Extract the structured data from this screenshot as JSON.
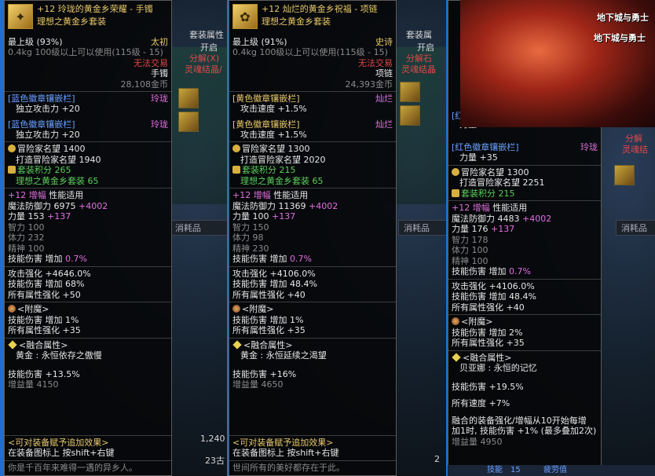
{
  "panels": [
    {
      "item_name": "+12 玲珑的黄金乡荣耀 - 手镯",
      "set_name": "理想之黄金乡套装",
      "grade": "最上级",
      "grade_pct": "(93%)",
      "rarity": "太初",
      "weight_req": "0.4kg  100级以上可以使用(115级 - 15)",
      "trade": "无法交易",
      "type": "手镯",
      "price": "28,108金币",
      "emblems": [
        {
          "slot": "[蓝色徽章镶嵌栏]",
          "gem": "玲珑",
          "stat": "独立攻击力 +20"
        },
        {
          "slot": "[蓝色徽章镶嵌栏]",
          "gem": "玲珑",
          "stat": "独立攻击力 +20"
        }
      ],
      "fame_label": "冒险家名望",
      "fame": "1400",
      "craft_fame_label": "打造冒险家名望",
      "craft_fame": "1940",
      "set_points_label": "套装积分",
      "set_points": "265",
      "set_line": "理想之黄金乡套装 65",
      "amp": "+12 增幅",
      "amp_note": "性能适用",
      "defense_label": "魔法防御力",
      "defense": "6975",
      "defense_bonus": "+4002",
      "stats": [
        {
          "label": "力量",
          "value": "153",
          "bonus": "+137"
        },
        {
          "label": "智力",
          "value": "100",
          "bonus": ""
        },
        {
          "label": "体力",
          "value": "232",
          "bonus": ""
        },
        {
          "label": "精神",
          "value": "100",
          "bonus": ""
        }
      ],
      "skill_line": "技能伤害 增加",
      "skill_val": "0.7%",
      "strong": [
        "攻击强化 +4646.0%",
        "技能伤害 增加 68%",
        "所有属性强化 +50"
      ],
      "enchant_label": "<附魔>",
      "enchant": [
        "技能伤害 增加 1%",
        "所有属性强化 +35"
      ],
      "fusion_label": "融合属性>",
      "fusion_name": "黄金 : 永恒依存之傲慢",
      "fusion_stats": [
        "技能伤害 +13.5%",
        "增益量 4150"
      ],
      "footer": [
        "<可对装备赋予追加效果>",
        "在装备图标上 按shift+右键",
        "你是千百年来难得一遇的异乡人。"
      ]
    },
    {
      "item_name": "+12 灿烂的黄金乡祝福 - 项链",
      "set_name": "理想之黄金乡套装",
      "grade": "最上级",
      "grade_pct": "(91%)",
      "rarity": "史诗",
      "weight_req": "0.4kg  100级以上可以使用(115级 - 15)",
      "trade": "无法交易",
      "type": "项链",
      "price": "24,393金币",
      "emblems": [
        {
          "slot": "[黄色徽章镶嵌栏]",
          "gem": "灿烂",
          "stat": "攻击速度 +1.5%"
        },
        {
          "slot": "[黄色徽章镶嵌栏]",
          "gem": "灿烂",
          "stat": "攻击速度 +1.5%"
        }
      ],
      "fame_label": "冒险家名望",
      "fame": "1300",
      "craft_fame_label": "打造冒险家名望",
      "craft_fame": "2020",
      "set_points_label": "套装积分",
      "set_points": "215",
      "set_line": "理想之黄金乡套装 65",
      "amp": "+12 增幅",
      "amp_note": "性能适用",
      "defense_label": "魔法防御力",
      "defense": "11369",
      "defense_bonus": "+4002",
      "stats": [
        {
          "label": "力量",
          "value": "100",
          "bonus": "+137"
        },
        {
          "label": "智力",
          "value": "150",
          "bonus": ""
        },
        {
          "label": "体力",
          "value": "98",
          "bonus": ""
        },
        {
          "label": "精神",
          "value": "230",
          "bonus": ""
        }
      ],
      "skill_line": "技能伤害 增加",
      "skill_val": "0.7%",
      "strong": [
        "攻击强化 +4106.0%",
        "技能伤害 增加 48.4%",
        "所有属性强化 +40"
      ],
      "enchant_label": "<附魔>",
      "enchant": [
        "技能伤害 增加 1%",
        "所有属性强化 +35"
      ],
      "fusion_label": "融合属性>",
      "fusion_name": "黄金 : 永恒延续之渴望",
      "fusion_stats": [
        "技能伤害 +16%",
        "增益量 4650"
      ],
      "footer": [
        "<可对装备赋予追加效果>",
        "在装备图标上 按shift+右键",
        "世间所有的美好都存在于此。"
      ]
    },
    {
      "emblem_top_slot": "[红色徽章镶嵌栏]",
      "emblem_top_gem": "玲珑",
      "emblem_top_partial": "力量 +35",
      "emblem_top_partial_head": "[红",
      "emblem_stat": "力量 +35",
      "fame_label": "冒险家名望",
      "fame": "1300",
      "craft_fame_label": "打造冒险家名望",
      "craft_fame": "2251",
      "set_points_label": "套装积分",
      "set_points": "215",
      "amp": "+12 增幅",
      "amp_note": "性能适用",
      "defense_label": "魔法防御力",
      "defense": "4483",
      "defense_bonus": "+4002",
      "stats": [
        {
          "label": "力量",
          "value": "176",
          "bonus": "+137"
        },
        {
          "label": "智力",
          "value": "178",
          "bonus": ""
        },
        {
          "label": "体力",
          "value": "100",
          "bonus": ""
        },
        {
          "label": "精神",
          "value": "100",
          "bonus": ""
        }
      ],
      "skill_line": "技能伤害 增加",
      "skill_val": "0.7%",
      "strong": [
        "攻击强化 +4106.0%",
        "技能伤害 增加 48.4%",
        "所有属性强化 +40"
      ],
      "enchant_label": "<附魔>",
      "enchant": [
        "技能伤害 增加 2%",
        "所有属性强化 +35"
      ],
      "fusion_label": "融合属性>",
      "fusion_name": "贝亚娜 : 永恒的记忆",
      "fusion_stats": [
        "技能伤害 +19.5%",
        "所有速度 +7%"
      ],
      "fusion_desc": [
        "融合的装备强化/增幅从10开始每增",
        "加1时, 技能伤害 +1% (最多叠加2次)"
      ],
      "fusion_buff": "增益量 4950"
    }
  ],
  "background": {
    "p1_frag": [
      "套装属性",
      "开启",
      "分解(X)",
      "灵魂结晶/"
    ],
    "p2_frag": [
      "套装属",
      "开启",
      "分解石",
      "灵魂结晶"
    ],
    "p3_frag": [
      "分解",
      "灵魂结"
    ],
    "tab_label": "消耗品",
    "num_1240": "1,240",
    "num_23": "23古",
    "num_2": "2",
    "p3_bottom": [
      "技能",
      "15",
      "疲劳值"
    ]
  }
}
